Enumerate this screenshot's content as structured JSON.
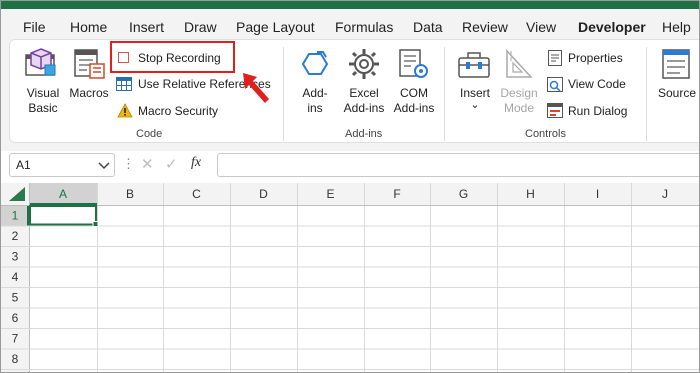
{
  "tabs": [
    "File",
    "Home",
    "Insert",
    "Draw",
    "Page Layout",
    "Formulas",
    "Data",
    "Review",
    "View",
    "Developer",
    "Help"
  ],
  "active_tab": "Developer",
  "ribbon": {
    "code": {
      "visual_basic": [
        "Visual",
        "Basic"
      ],
      "macros": "Macros",
      "stop_recording": "Stop Recording",
      "use_relative": "Use Relative References",
      "macro_security": "Macro Security",
      "group_label": "Code"
    },
    "addins": {
      "addins": [
        "Add-",
        "ins"
      ],
      "excel_addins": [
        "Excel",
        "Add-ins"
      ],
      "com_addins": [
        "COM",
        "Add-ins"
      ],
      "group_label": "Add-ins"
    },
    "controls": {
      "insert": "Insert",
      "insert_caret": "⌄",
      "design_mode": [
        "Design",
        "Mode"
      ],
      "properties": "Properties",
      "view_code": "View Code",
      "run_dialog": "Run Dialog",
      "group_label": "Controls"
    },
    "source": "Source"
  },
  "formula_bar": {
    "name_box": "A1",
    "cancel_glyph": "✕",
    "enter_glyph": "✓",
    "fx_label": "fx",
    "formula": ""
  },
  "grid": {
    "columns": [
      "A",
      "B",
      "C",
      "D",
      "E",
      "F",
      "G",
      "H",
      "I",
      "J"
    ],
    "rows": [
      "1",
      "2",
      "3",
      "4",
      "5",
      "6",
      "7",
      "8"
    ],
    "selected_cell": "A1"
  },
  "colors": {
    "brand_green": "#1e7145",
    "highlight_red": "#e0201c",
    "selected_header": "#d2d2d2",
    "selected_header_text": "#1e7145"
  }
}
